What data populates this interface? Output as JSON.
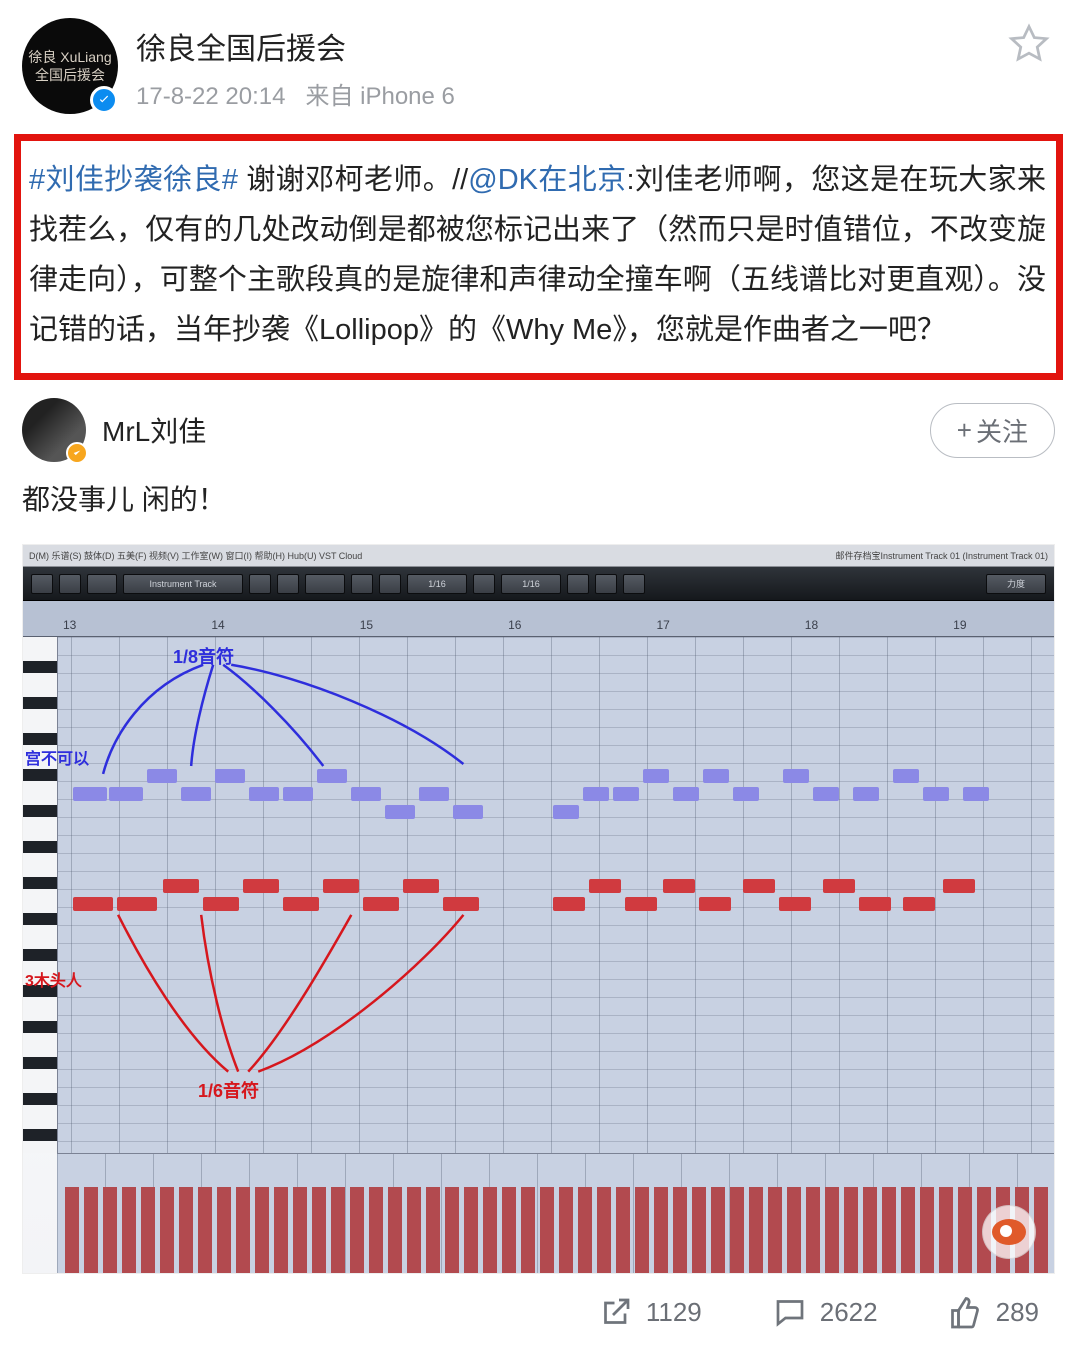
{
  "header": {
    "avatar_text": "徐良 XuLiang\n全国后援会",
    "user_name": "徐良全国后援会",
    "timestamp": "17-8-22 20:14",
    "source_prefix": "来自 ",
    "source_device": "iPhone 6"
  },
  "post": {
    "hashtag": "#刘佳抄袭徐良#",
    "text_1": " 谢谢邓柯老师。//",
    "mention": "@DK在北京",
    "text_2": ":刘佳老师啊，您这是在玩大家来找茬么，仅有的几处改动倒是都被您标记出来了（然而只是时值错位，不改变旋律走向），可整个主歌段真的是旋律和声律动全撞车啊（五线谱比对更直观）。没记错的话，当年抄袭《Lollipop》的《Why Me》，您就是作曲者之一吧？"
  },
  "quoted": {
    "user_name": "MrL刘佳",
    "follow_label": "关注",
    "text": "都没事儿 闲的！"
  },
  "daw": {
    "menu": "D(M)  乐谱(S)  鼓体(D)  五美(F)  视频(V)  工作室(W)  窗口(I)  帮助(H)  Hub(U)  VST Cloud",
    "track_info": "邮件存档宝Instrument Track 01 (Instrument Track 01)",
    "ruler_marks": [
      "13",
      "14",
      "15",
      "16",
      "17",
      "18",
      "19"
    ],
    "label_blue_note": "1/8音符",
    "label_red_note": "1/6音符",
    "side_blue": "宫不可以",
    "side_red": "3木头人",
    "toolbar_label_1": "Instrument Track",
    "quantize_1": "1/16",
    "quantize_2": "1/16",
    "velocity_label": "力度"
  },
  "actions": {
    "share_count": "1129",
    "comment_count": "2622",
    "like_count": "289"
  }
}
